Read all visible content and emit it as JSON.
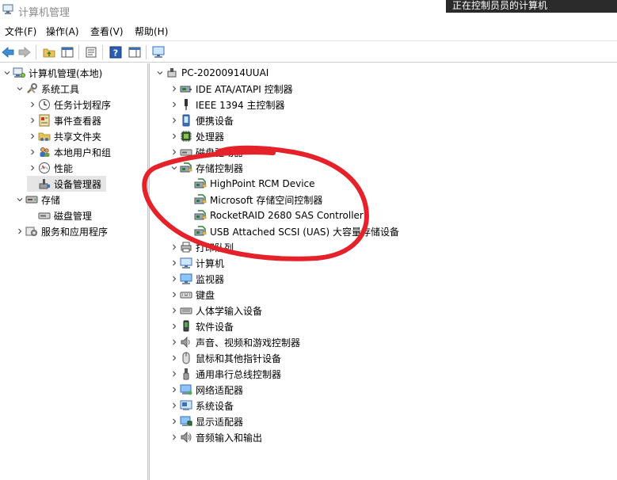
{
  "window": {
    "title": "计算机管理",
    "tooltip": "正在控制员员的计算机"
  },
  "menu": [
    "文件(F)",
    "操作(A)",
    "查看(V)",
    "帮助(H)"
  ],
  "left_tree": [
    {
      "label": "计算机管理(本地)",
      "icon": "computer-management-icon",
      "chevron": "down",
      "level": 0
    },
    {
      "label": "系统工具",
      "icon": "tools-icon",
      "chevron": "down",
      "level": 1
    },
    {
      "label": "任务计划程序",
      "icon": "clock-icon",
      "chevron": "right",
      "level": 2
    },
    {
      "label": "事件查看器",
      "icon": "event-viewer-icon",
      "chevron": "right",
      "level": 2
    },
    {
      "label": "共享文件夹",
      "icon": "shared-folder-icon",
      "chevron": "right",
      "level": 2
    },
    {
      "label": "本地用户和组",
      "icon": "users-icon",
      "chevron": "right",
      "level": 2
    },
    {
      "label": "性能",
      "icon": "performance-icon",
      "chevron": "right",
      "level": 2
    },
    {
      "label": "设备管理器",
      "icon": "device-manager-icon",
      "chevron": "none",
      "level": 2,
      "selected": true
    },
    {
      "label": "存储",
      "icon": "storage-icon",
      "chevron": "down",
      "level": 1
    },
    {
      "label": "磁盘管理",
      "icon": "disk-management-icon",
      "chevron": "none",
      "level": 2
    },
    {
      "label": "服务和应用程序",
      "icon": "services-icon",
      "chevron": "right",
      "level": 1
    }
  ],
  "right_tree": [
    {
      "label": "PC-20200914UUAI",
      "icon": "pc-icon",
      "chevron": "down",
      "level": 0
    },
    {
      "label": "IDE ATA/ATAPI 控制器",
      "icon": "controller-icon",
      "chevron": "right",
      "level": 1
    },
    {
      "label": "IEEE 1394 主控制器",
      "icon": "firewire-icon",
      "chevron": "right",
      "level": 1
    },
    {
      "label": "便携设备",
      "icon": "portable-device-icon",
      "chevron": "right",
      "level": 1
    },
    {
      "label": "处理器",
      "icon": "processor-icon",
      "chevron": "right",
      "level": 1
    },
    {
      "label": "磁盘驱动器",
      "icon": "disk-drive-icon",
      "chevron": "right",
      "level": 1
    },
    {
      "label": "存储控制器",
      "icon": "storage-controller-icon",
      "chevron": "down",
      "level": 1
    },
    {
      "label": "HighPoint RCM Device",
      "icon": "storage-controller-icon",
      "chevron": "none",
      "level": 2
    },
    {
      "label": "Microsoft 存储空间控制器",
      "icon": "storage-controller-icon",
      "chevron": "none",
      "level": 2
    },
    {
      "label": "RocketRAID 2680 SAS Controller",
      "icon": "storage-controller-icon",
      "chevron": "none",
      "level": 2
    },
    {
      "label": "USB Attached SCSI (UAS) 大容量存储设备",
      "icon": "storage-controller-icon",
      "chevron": "none",
      "level": 2
    },
    {
      "label": "打印队列",
      "icon": "printer-icon",
      "chevron": "right",
      "level": 1
    },
    {
      "label": "计算机",
      "icon": "computer-icon",
      "chevron": "right",
      "level": 1
    },
    {
      "label": "监视器",
      "icon": "monitor-icon",
      "chevron": "right",
      "level": 1
    },
    {
      "label": "键盘",
      "icon": "keyboard-icon",
      "chevron": "right",
      "level": 1
    },
    {
      "label": "人体学输入设备",
      "icon": "hid-icon",
      "chevron": "right",
      "level": 1
    },
    {
      "label": "软件设备",
      "icon": "software-device-icon",
      "chevron": "right",
      "level": 1
    },
    {
      "label": "声音、视频和游戏控制器",
      "icon": "speaker-icon",
      "chevron": "right",
      "level": 1
    },
    {
      "label": "鼠标和其他指针设备",
      "icon": "mouse-icon",
      "chevron": "right",
      "level": 1
    },
    {
      "label": "通用串行总线控制器",
      "icon": "usb-icon",
      "chevron": "right",
      "level": 1
    },
    {
      "label": "网络适配器",
      "icon": "network-adapter-icon",
      "chevron": "right",
      "level": 1
    },
    {
      "label": "系统设备",
      "icon": "system-device-icon",
      "chevron": "right",
      "level": 1
    },
    {
      "label": "显示适配器",
      "icon": "display-adapter-icon",
      "chevron": "right",
      "level": 1
    },
    {
      "label": "音频输入和输出",
      "icon": "audio-io-icon",
      "chevron": "right",
      "level": 1
    }
  ],
  "toolbar_icons": [
    "back-arrow-icon",
    "forward-arrow-icon",
    "up-folder-icon",
    "show-hide-tree-icon",
    "properties-icon",
    "help-icon",
    "action-pane-icon",
    "monitor-scan-icon"
  ],
  "colors": {
    "annotation": "#e5222a",
    "selection": "#e5e5e5"
  }
}
